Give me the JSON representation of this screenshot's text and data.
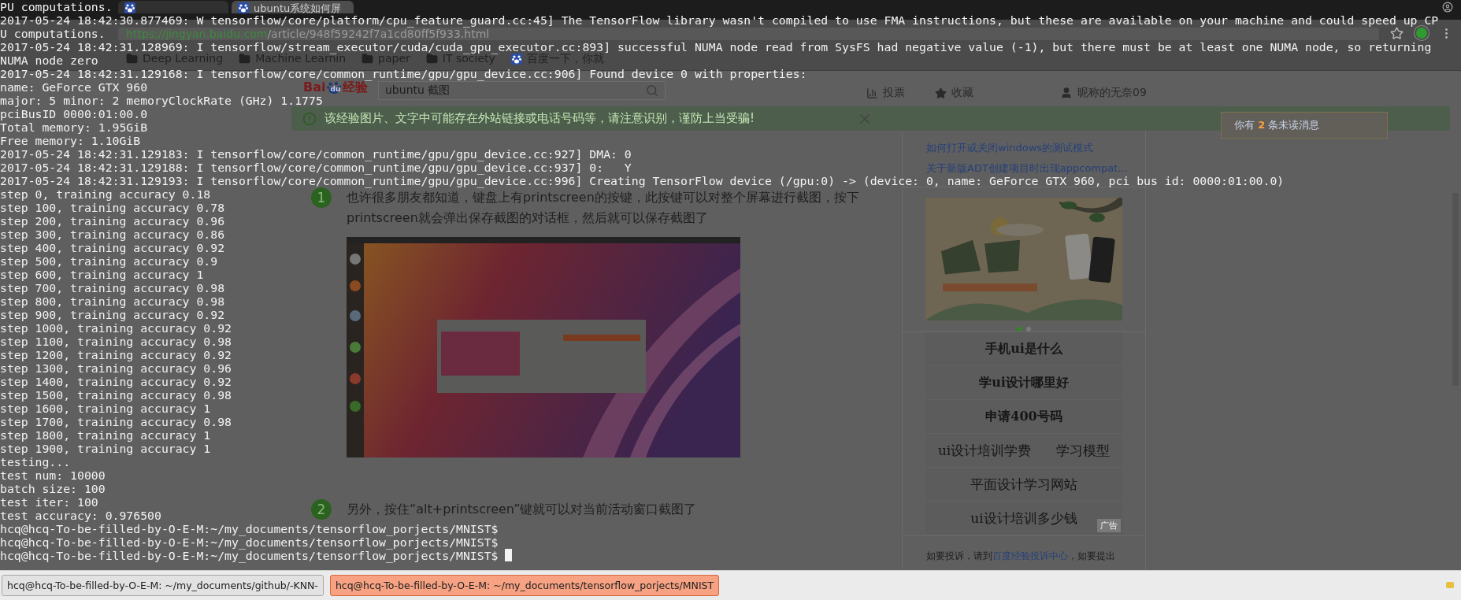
{
  "browser": {
    "tabs": [
      {
        "selected": false
      },
      {
        "title": "ubuntu系统如何屏",
        "selected": true
      }
    ],
    "address": {
      "host": "https://jingyan.baidu.com",
      "path": "/article/948f59242f7a1cd80ff5f933.html"
    },
    "bookmarks": [
      {
        "kind": "folder",
        "label": "Deep Learning"
      },
      {
        "kind": "folder",
        "label": "Machine Learnin"
      },
      {
        "kind": "folder",
        "label": "paper"
      },
      {
        "kind": "folder",
        "label": "IT society"
      },
      {
        "kind": "page",
        "label": "百度一下，你就"
      }
    ]
  },
  "page": {
    "logo": {
      "left": "Bai",
      "paw": "du",
      "right": "经验"
    },
    "search": {
      "value": "ubuntu 截图"
    },
    "nav": [
      {
        "kind": "chart",
        "label": "投票"
      },
      {
        "kind": "star",
        "label": "收藏"
      },
      {
        "kind": "user",
        "label": "昵称的无奈09"
      }
    ],
    "notice": "该经验图片、文字中可能存在外站链接或电话号码等，请注意识别，谨防上当受骗!",
    "message": "你有 **2** 条未读消息",
    "steps": [
      {
        "number": "1",
        "text": "也许很多朋友都知道，键盘上有printscreen的按键，此按键可以对整个屏幕进行截图，按下printscreen就会弹出保存截图的对话框，然后就可以保存截图了",
        "has_picture": true
      },
      {
        "number": "2",
        "text": "另外，按住“alt+printscreen”键就可以对当前活动窗口截图了",
        "has_picture": false
      }
    ],
    "related_links": [
      "如何打开或关闭windows的测试模式",
      "关于新版ADT创建项目时出现appcompat..."
    ],
    "ad_dots": [
      {
        "selected": true
      },
      {
        "selected": false
      }
    ],
    "searches": [
      {
        "bold": true,
        "items": [
          "手机ui是什么"
        ]
      },
      {
        "bold": true,
        "items": [
          "学ui设计哪里好"
        ]
      },
      {
        "bold": true,
        "items": [
          "申请400号码"
        ]
      },
      {
        "bold": false,
        "items": [
          "ui设计培训学费",
          "学习模型"
        ]
      },
      {
        "bold": false,
        "items": [
          "平面设计学习网站"
        ]
      },
      {
        "bold": false,
        "items": [
          "ui设计培训多少钱"
        ]
      }
    ],
    "ad_badge": "广告",
    "complaint": {
      "before": "如要投诉，请到",
      "link": "百度经验投诉中心",
      "after": "，如要提出"
    }
  },
  "terminal": {
    "lines": [
      "PU computations.",
      "2017-05-24 18:42:30.877469: W tensorflow/core/platform/cpu_feature_guard.cc:45] The TensorFlow library wasn't compiled to use FMA instructions, but these are available on your machine and could speed up CP",
      "U computations.",
      "2017-05-24 18:42:31.128969: I tensorflow/stream_executor/cuda/cuda_gpu_executor.cc:893] successful NUMA node read from SysFS had negative value (-1), but there must be at least one NUMA node, so returning",
      "NUMA node zero",
      "2017-05-24 18:42:31.129168: I tensorflow/core/common_runtime/gpu/gpu_device.cc:906] Found device 0 with properties:",
      "name: GeForce GTX 960",
      "major: 5 minor: 2 memoryClockRate (GHz) 1.1775",
      "pciBusID 0000:01:00.0",
      "Total memory: 1.95GiB",
      "Free memory: 1.10GiB",
      "2017-05-24 18:42:31.129183: I tensorflow/core/common_runtime/gpu/gpu_device.cc:927] DMA: 0",
      "2017-05-24 18:42:31.129188: I tensorflow/core/common_runtime/gpu/gpu_device.cc:937] 0:   Y",
      "2017-05-24 18:42:31.129193: I tensorflow/core/common_runtime/gpu/gpu_device.cc:996] Creating TensorFlow device (/gpu:0) -> (device: 0, name: GeForce GTX 960, pci bus id: 0000:01:00.0)",
      "step 0, training accuracy 0.18",
      "step 100, training accuracy 0.78",
      "step 200, training accuracy 0.96",
      "step 300, training accuracy 0.86",
      "step 400, training accuracy 0.92",
      "step 500, training accuracy 0.9",
      "step 600, training accuracy 1",
      "step 700, training accuracy 0.98",
      "step 800, training accuracy 0.98",
      "step 900, training accuracy 0.92",
      "step 1000, training accuracy 0.92",
      "step 1100, training accuracy 0.98",
      "step 1200, training accuracy 0.92",
      "step 1300, training accuracy 0.96",
      "step 1400, training accuracy 0.92",
      "step 1500, training accuracy 0.98",
      "step 1600, training accuracy 1",
      "step 1700, training accuracy 0.98",
      "step 1800, training accuracy 1",
      "step 1900, training accuracy 1",
      "testing...",
      "test num: 10000",
      "batch size: 100",
      "test iter: 100",
      "test accuracy: 0.976500",
      "hcq@hcq-To-be-filled-by-O-E-M:~/my_documents/tensorflow_porjects/MNIST$",
      "hcq@hcq-To-be-filled-by-O-E-M:~/my_documents/tensorflow_porjects/MNIST$",
      "hcq@hcq-To-be-filled-by-O-E-M:~/my_documents/tensorflow_porjects/MNIST$ "
    ],
    "cursor": true
  },
  "taskbar": [
    {
      "label": "hcq@hcq-To-be-filled-by-O-E-M: ~/my_documents/github/-KNN-",
      "selected": false
    },
    {
      "label": "hcq@hcq-To-be-filled-by-O-E-M: ~/my_documents/tensorflow_porjects/MNIST",
      "selected": true
    }
  ]
}
